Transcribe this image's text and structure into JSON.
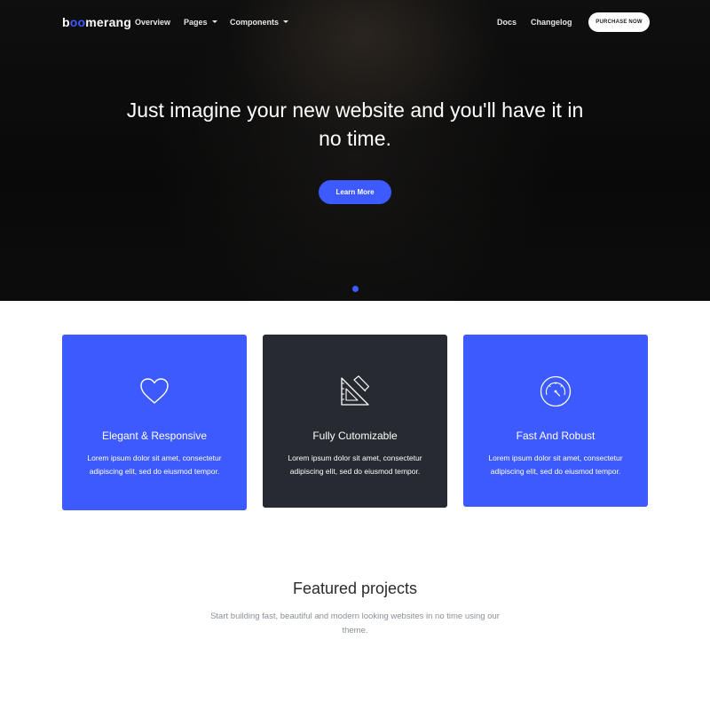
{
  "navbar": {
    "brand_prefix": "b",
    "brand_oo": "oo",
    "brand_suffix": "merang",
    "links": [
      {
        "label": "Overview"
      },
      {
        "label": "Pages"
      },
      {
        "label": "Components"
      },
      {
        "label": "Docs"
      },
      {
        "label": "Changelog"
      }
    ],
    "purchase_label": "PURCHASE NOW"
  },
  "hero": {
    "title": "Just imagine your new website and you'll have it in no time.",
    "cta_label": "Learn More",
    "active_slide": 1
  },
  "features": [
    {
      "icon": "heart-icon",
      "title": "Elegant & Responsive",
      "text": "Lorem ipsum dolor sit amet, consectetur adipiscing elit, sed do eiusmod tempor.",
      "color": "#3d5afe"
    },
    {
      "icon": "ruler-triangle-icon",
      "title": "Fully Cutomizable",
      "text": "Lorem ipsum dolor sit amet, consectetur adipiscing elit, sed do eiusmod tempor.",
      "color": "#272b31"
    },
    {
      "icon": "speedometer-icon",
      "title": "Fast And Robust",
      "text": "Lorem ipsum dolor sit amet, consectetur adipiscing elit, sed do eiusmod tempor.",
      "color": "#3d5afe"
    }
  ],
  "featured": {
    "title": "Featured projects",
    "subtitle": "Start building fast, beautiful and modern looking websites in no time using our theme."
  },
  "colors": {
    "accent": "#3d5afe",
    "dark_card": "#272b31"
  }
}
